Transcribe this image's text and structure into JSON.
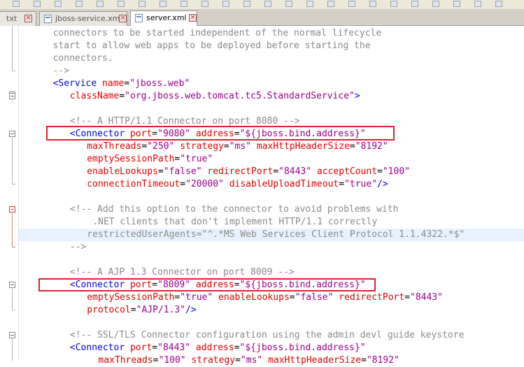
{
  "tabs": [
    {
      "label": "txt",
      "active": false
    },
    {
      "label": "jboss-service.xml",
      "active": false
    },
    {
      "label": "server.xml",
      "active": true
    }
  ],
  "toolbar_icons": [
    "new-icon",
    "open-icon",
    "save-icon",
    "save-all-icon",
    "close-icon",
    "print-icon",
    "cut-icon",
    "copy-icon",
    "paste-icon",
    "undo-icon",
    "redo-icon",
    "find-icon",
    "replace-icon",
    "zoom-in-icon",
    "zoom-out-icon",
    "sync-icon",
    "wrap-icon",
    "indent-icon",
    "bookmark-icon",
    "macro-icon",
    "run-icon",
    "record-icon",
    "play-icon",
    "settings-icon"
  ],
  "code_lines": [
    {
      "indent": 6,
      "tokens": [
        {
          "t": "comment",
          "s": "connectors to be started independent of the normal lifecycle"
        }
      ]
    },
    {
      "indent": 6,
      "tokens": [
        {
          "t": "comment",
          "s": "start to allow web apps to be deployed before starting the"
        }
      ]
    },
    {
      "indent": 6,
      "tokens": [
        {
          "t": "comment",
          "s": "connectors."
        }
      ]
    },
    {
      "indent": 6,
      "tokens": [
        {
          "t": "comment",
          "s": "-->"
        }
      ]
    },
    {
      "indent": 6,
      "tokens": [
        {
          "t": "tag",
          "s": "<Service "
        },
        {
          "t": "attr",
          "s": "name"
        },
        {
          "t": "text",
          "s": "="
        },
        {
          "t": "val",
          "s": "\"jboss.web\""
        }
      ]
    },
    {
      "indent": 9,
      "tokens": [
        {
          "t": "attr",
          "s": "className"
        },
        {
          "t": "text",
          "s": "="
        },
        {
          "t": "val",
          "s": "\"org.jboss.web.tomcat.tc5.StandardService\""
        },
        {
          "t": "tag",
          "s": ">"
        }
      ]
    },
    {
      "indent": 0,
      "tokens": []
    },
    {
      "indent": 9,
      "tokens": [
        {
          "t": "comment",
          "s": "<!-- A HTTP/1.1 Connector on port 8080 -->"
        }
      ]
    },
    {
      "indent": 9,
      "tokens": [
        {
          "t": "tag",
          "s": "<Connector "
        },
        {
          "t": "attr",
          "s": "port"
        },
        {
          "t": "text",
          "s": "="
        },
        {
          "t": "val",
          "s": "\"9080\""
        },
        {
          "t": "text",
          "s": " "
        },
        {
          "t": "attr",
          "s": "address"
        },
        {
          "t": "text",
          "s": "="
        },
        {
          "t": "val",
          "s": "\"${jboss.bind.address}\""
        }
      ]
    },
    {
      "indent": 12,
      "tokens": [
        {
          "t": "attr",
          "s": "maxThreads"
        },
        {
          "t": "text",
          "s": "="
        },
        {
          "t": "val",
          "s": "\"250\""
        },
        {
          "t": "text",
          "s": " "
        },
        {
          "t": "attr",
          "s": "strategy"
        },
        {
          "t": "text",
          "s": "="
        },
        {
          "t": "val",
          "s": "\"ms\""
        },
        {
          "t": "text",
          "s": " "
        },
        {
          "t": "attr",
          "s": "maxHttpHeaderSize"
        },
        {
          "t": "text",
          "s": "="
        },
        {
          "t": "val",
          "s": "\"8192\""
        }
      ]
    },
    {
      "indent": 12,
      "tokens": [
        {
          "t": "attr",
          "s": "emptySessionPath"
        },
        {
          "t": "text",
          "s": "="
        },
        {
          "t": "val",
          "s": "\"true\""
        }
      ]
    },
    {
      "indent": 12,
      "tokens": [
        {
          "t": "attr",
          "s": "enableLookups"
        },
        {
          "t": "text",
          "s": "="
        },
        {
          "t": "val",
          "s": "\"false\""
        },
        {
          "t": "text",
          "s": " "
        },
        {
          "t": "attr",
          "s": "redirectPort"
        },
        {
          "t": "text",
          "s": "="
        },
        {
          "t": "val",
          "s": "\"8443\""
        },
        {
          "t": "text",
          "s": " "
        },
        {
          "t": "attr",
          "s": "acceptCount"
        },
        {
          "t": "text",
          "s": "="
        },
        {
          "t": "val",
          "s": "\"100\""
        }
      ]
    },
    {
      "indent": 12,
      "tokens": [
        {
          "t": "attr",
          "s": "connectionTimeout"
        },
        {
          "t": "text",
          "s": "="
        },
        {
          "t": "val",
          "s": "\"20000\""
        },
        {
          "t": "text",
          "s": " "
        },
        {
          "t": "attr",
          "s": "disableUploadTimeout"
        },
        {
          "t": "text",
          "s": "="
        },
        {
          "t": "val",
          "s": "\"true\""
        },
        {
          "t": "tag",
          "s": "/>"
        }
      ]
    },
    {
      "indent": 0,
      "tokens": []
    },
    {
      "indent": 9,
      "tokens": [
        {
          "t": "comment",
          "s": "<!-- Add this option to the connector to avoid problems with"
        }
      ]
    },
    {
      "indent": 13,
      "tokens": [
        {
          "t": "comment",
          "s": ".NET clients that don't implement HTTP/1.1 correctly"
        }
      ]
    },
    {
      "indent": 12,
      "tokens": [
        {
          "t": "comment",
          "s": "restrictedUserAgents=\"^.*MS Web Services Client Protocol 1.1.4322.*$\""
        }
      ]
    },
    {
      "indent": 9,
      "tokens": [
        {
          "t": "comment",
          "s": "-->"
        }
      ]
    },
    {
      "indent": 0,
      "tokens": []
    },
    {
      "indent": 9,
      "tokens": [
        {
          "t": "comment",
          "s": "<!-- A AJP 1.3 Connector on port 8009 -->"
        }
      ]
    },
    {
      "indent": 9,
      "tokens": [
        {
          "t": "tag",
          "s": "<Connector "
        },
        {
          "t": "attr",
          "s": "port"
        },
        {
          "t": "text",
          "s": "="
        },
        {
          "t": "val",
          "s": "\"8009\""
        },
        {
          "t": "text",
          "s": " "
        },
        {
          "t": "attr",
          "s": "address"
        },
        {
          "t": "text",
          "s": "="
        },
        {
          "t": "val",
          "s": "\"${jboss.bind.address}\""
        }
      ]
    },
    {
      "indent": 12,
      "tokens": [
        {
          "t": "attr",
          "s": "emptySessionPath"
        },
        {
          "t": "text",
          "s": "="
        },
        {
          "t": "val",
          "s": "\"true\""
        },
        {
          "t": "text",
          "s": " "
        },
        {
          "t": "attr",
          "s": "enableLookups"
        },
        {
          "t": "text",
          "s": "="
        },
        {
          "t": "val",
          "s": "\"false\""
        },
        {
          "t": "text",
          "s": " "
        },
        {
          "t": "attr",
          "s": "redirectPort"
        },
        {
          "t": "text",
          "s": "="
        },
        {
          "t": "val",
          "s": "\"8443\""
        }
      ]
    },
    {
      "indent": 12,
      "tokens": [
        {
          "t": "attr",
          "s": "protocol"
        },
        {
          "t": "text",
          "s": "="
        },
        {
          "t": "val",
          "s": "\"AJP/1.3\""
        },
        {
          "t": "tag",
          "s": "/>"
        }
      ]
    },
    {
      "indent": 0,
      "tokens": []
    },
    {
      "indent": 9,
      "tokens": [
        {
          "t": "comment",
          "s": "<!-- SSL/TLS Connector configuration using the admin devl guide keystore"
        }
      ]
    },
    {
      "indent": 9,
      "tokens": [
        {
          "t": "tag",
          "s": "<Connector "
        },
        {
          "t": "attr",
          "s": "port"
        },
        {
          "t": "text",
          "s": "="
        },
        {
          "t": "val",
          "s": "\"8443\""
        },
        {
          "t": "text",
          "s": " "
        },
        {
          "t": "attr",
          "s": "address"
        },
        {
          "t": "text",
          "s": "="
        },
        {
          "t": "val",
          "s": "\"${jboss.bind.address}\""
        }
      ]
    },
    {
      "indent": 14,
      "tokens": [
        {
          "t": "attr",
          "s": "maxThreads"
        },
        {
          "t": "text",
          "s": "="
        },
        {
          "t": "val",
          "s": "\"100\""
        },
        {
          "t": "text",
          "s": " "
        },
        {
          "t": "attr",
          "s": "strategy"
        },
        {
          "t": "text",
          "s": "="
        },
        {
          "t": "val",
          "s": "\"ms\""
        },
        {
          "t": "text",
          "s": " "
        },
        {
          "t": "attr",
          "s": "maxHttpHeaderSize"
        },
        {
          "t": "text",
          "s": "="
        },
        {
          "t": "val",
          "s": "\"8192\""
        }
      ]
    }
  ],
  "highlighted_line": 16,
  "annotation_boxes": [
    "connector-9080-highlight",
    "connector-8009-highlight"
  ],
  "colors": {
    "comment": "#8a8a8a",
    "tag": "#0000e6",
    "attr": "#e60000",
    "value": "#9a008a",
    "current_line": "#e8f2fe",
    "annotation": "#e0202e"
  }
}
